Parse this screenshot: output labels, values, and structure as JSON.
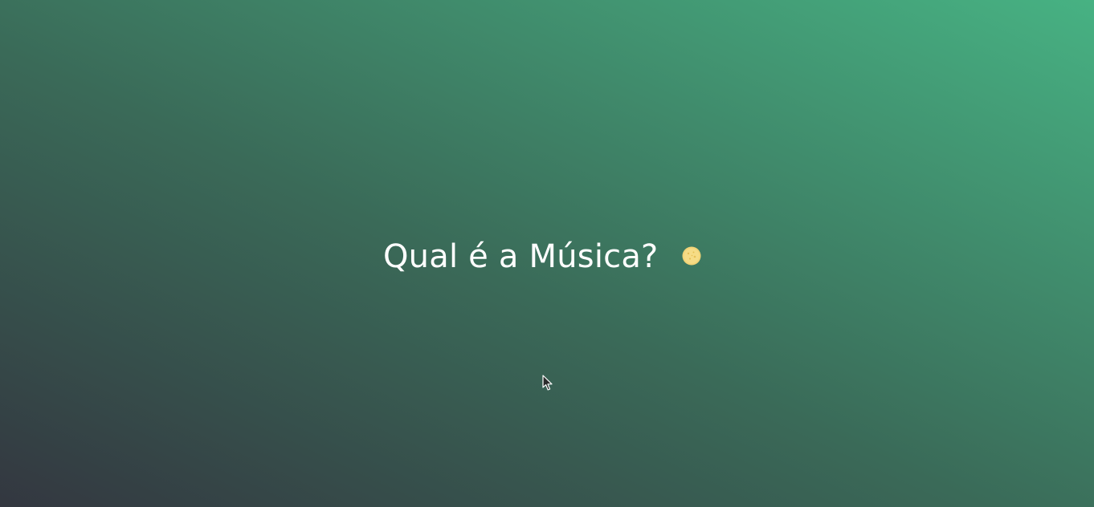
{
  "page": {
    "title": "Qual é a Música?"
  },
  "icons": {
    "title_badge": "gold-coin-icon",
    "pointer": "mouse-cursor-icon"
  },
  "colors": {
    "background_start": "#333740",
    "background_end": "#47b283",
    "title_text": "#ffffff",
    "coin": "#f2d477"
  }
}
